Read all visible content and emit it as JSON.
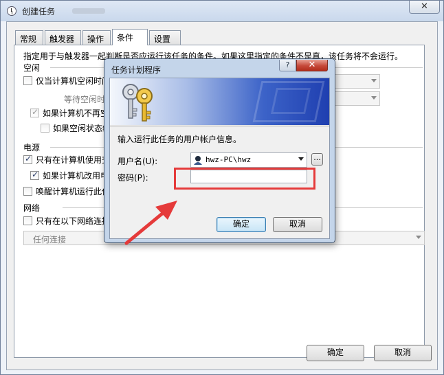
{
  "window": {
    "title": "创建任务",
    "close_glyph": "✕"
  },
  "tabs": [
    {
      "label": "常规"
    },
    {
      "label": "触发器"
    },
    {
      "label": "操作"
    },
    {
      "label": "条件"
    },
    {
      "label": "设置"
    }
  ],
  "conditions": {
    "description": "指定用于与触发器一起判断是否应运行该任务的条件。如果这里指定的条件不是真，该任务将不会运行。",
    "idle": {
      "header": "空闲",
      "start_if_idle": {
        "label": "仅当计算机空闲时间",
        "checked": false
      },
      "wait_for_idle": "等待空闲时",
      "stop_if_not_idle": {
        "label": "如果计算机不再空",
        "checked": true
      },
      "restart_if_idle": {
        "label": "如果空闲状态继",
        "checked": false
      }
    },
    "power": {
      "header": "电源",
      "only_on_ac": {
        "label": "只有在计算机使用交",
        "checked": true
      },
      "stop_on_battery": {
        "label": "如果计算机改用电",
        "checked": true
      },
      "wake_to_run": {
        "label": "唤醒计算机运行此任",
        "checked": false
      }
    },
    "network": {
      "header": "网络",
      "only_if_network": {
        "label": "只有在以下网络连接",
        "checked": false
      },
      "connection_value": "任何连接"
    }
  },
  "footer": {
    "ok_label": "确定",
    "cancel_label": "取消"
  },
  "dialog": {
    "title": "任务计划程序",
    "help_glyph": "?",
    "close_glyph": "✕",
    "prompt": "输入运行此任务的用户帐户信息。",
    "username_label": "用户名(U):",
    "username_value": "hwz-PC\\hwz",
    "browse_label": "...",
    "password_label": "密码(P):",
    "password_value": "",
    "ok_label": "确定",
    "cancel_label": "取消"
  },
  "annotation": {
    "highlight_color": "#e53a3a"
  }
}
